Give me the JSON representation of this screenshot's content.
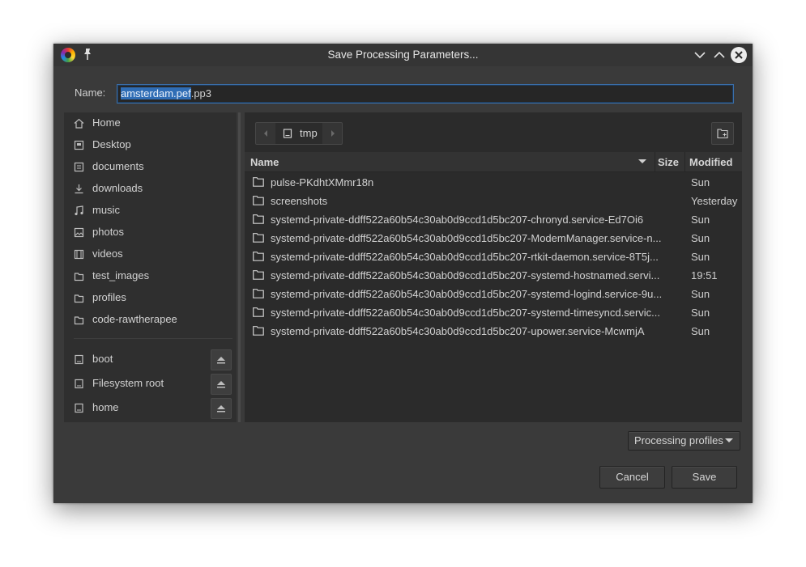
{
  "window": {
    "title": "Save Processing Parameters..."
  },
  "name_field": {
    "label": "Name:",
    "value_selected": "amsterdam.pef",
    "value_rest": ".pp3"
  },
  "places": [
    {
      "label": "Home",
      "icon": "home-icon"
    },
    {
      "label": "Desktop",
      "icon": "desktop-icon"
    },
    {
      "label": "documents",
      "icon": "documents-icon"
    },
    {
      "label": "downloads",
      "icon": "downloads-icon"
    },
    {
      "label": "music",
      "icon": "music-icon"
    },
    {
      "label": "photos",
      "icon": "photos-icon"
    },
    {
      "label": "videos",
      "icon": "videos-icon"
    },
    {
      "label": "test_images",
      "icon": "folder-icon"
    },
    {
      "label": "profiles",
      "icon": "folder-icon"
    },
    {
      "label": "code-rawtherapee",
      "icon": "folder-icon"
    }
  ],
  "devices": [
    {
      "label": "boot",
      "icon": "drive-icon"
    },
    {
      "label": "Filesystem root",
      "icon": "drive-icon"
    },
    {
      "label": "home",
      "icon": "drive-icon"
    }
  ],
  "path_bar": {
    "current": "tmp"
  },
  "columns": {
    "name": "Name",
    "size": "Size",
    "modified": "Modified"
  },
  "files": [
    {
      "name": "pulse-PKdhtXMmr18n",
      "modified": "Sun"
    },
    {
      "name": "screenshots",
      "modified": "Yesterday"
    },
    {
      "name": "systemd-private-ddff522a60b54c30ab0d9ccd1d5bc207-chronyd.service-Ed7Oi6",
      "modified": "Sun"
    },
    {
      "name": "systemd-private-ddff522a60b54c30ab0d9ccd1d5bc207-ModemManager.service-n...",
      "modified": "Sun"
    },
    {
      "name": "systemd-private-ddff522a60b54c30ab0d9ccd1d5bc207-rtkit-daemon.service-8T5j...",
      "modified": "Sun"
    },
    {
      "name": "systemd-private-ddff522a60b54c30ab0d9ccd1d5bc207-systemd-hostnamed.servi...",
      "modified": "19:51"
    },
    {
      "name": "systemd-private-ddff522a60b54c30ab0d9ccd1d5bc207-systemd-logind.service-9u...",
      "modified": "Sun"
    },
    {
      "name": "systemd-private-ddff522a60b54c30ab0d9ccd1d5bc207-systemd-timesyncd.servic...",
      "modified": "Sun"
    },
    {
      "name": "systemd-private-ddff522a60b54c30ab0d9ccd1d5bc207-upower.service-McwmjA",
      "modified": "Sun"
    }
  ],
  "filter": {
    "label": "Processing profiles"
  },
  "buttons": {
    "cancel": "Cancel",
    "save": "Save"
  },
  "colors": {
    "dialog_bg": "#3a3a3a",
    "selection": "#2f6db5",
    "list_bg": "#2b2b2b"
  }
}
